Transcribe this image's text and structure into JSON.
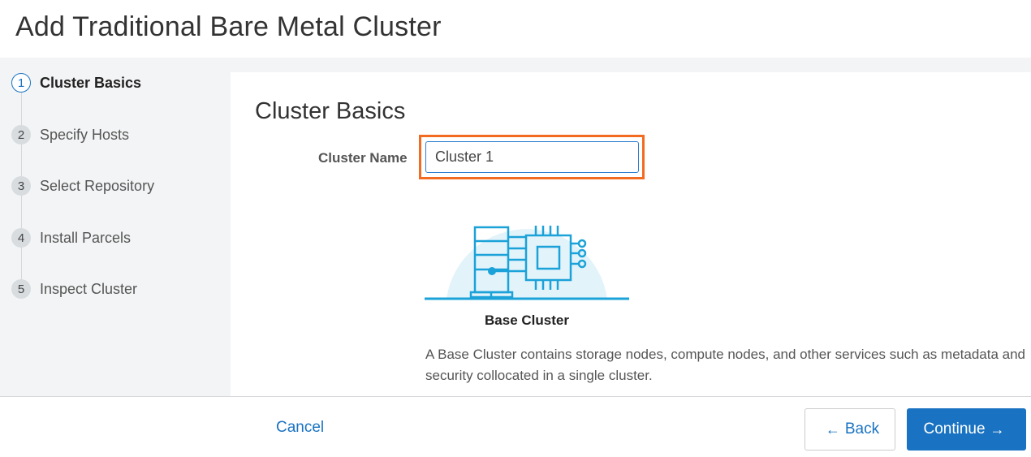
{
  "page": {
    "title": "Add Traditional Bare Metal Cluster"
  },
  "steps": [
    {
      "number": "1",
      "label": "Cluster Basics",
      "active": true
    },
    {
      "number": "2",
      "label": "Specify Hosts",
      "active": false
    },
    {
      "number": "3",
      "label": "Select Repository",
      "active": false
    },
    {
      "number": "4",
      "label": "Install Parcels",
      "active": false
    },
    {
      "number": "5",
      "label": "Inspect Cluster",
      "active": false
    }
  ],
  "main": {
    "section_title": "Cluster Basics",
    "cluster_name_label": "Cluster Name",
    "cluster_name_value": "Cluster 1",
    "card": {
      "icon": "server-chip-icon",
      "title": "Base Cluster",
      "description": "A Base Cluster contains storage nodes, compute nodes, and other services such as metadata and security collocated in a single cluster."
    }
  },
  "footer": {
    "cancel_label": "Cancel",
    "back_label": "Back",
    "continue_label": "Continue",
    "back_icon": "arrow-left-icon",
    "continue_icon": "arrow-right-icon"
  },
  "colors": {
    "accent": "#1a73c2",
    "highlight": "#f26b21",
    "sidebar_bg": "#f3f4f5",
    "illustration_stroke": "#1ba2d8",
    "illustration_bg": "#e3f3fa"
  }
}
